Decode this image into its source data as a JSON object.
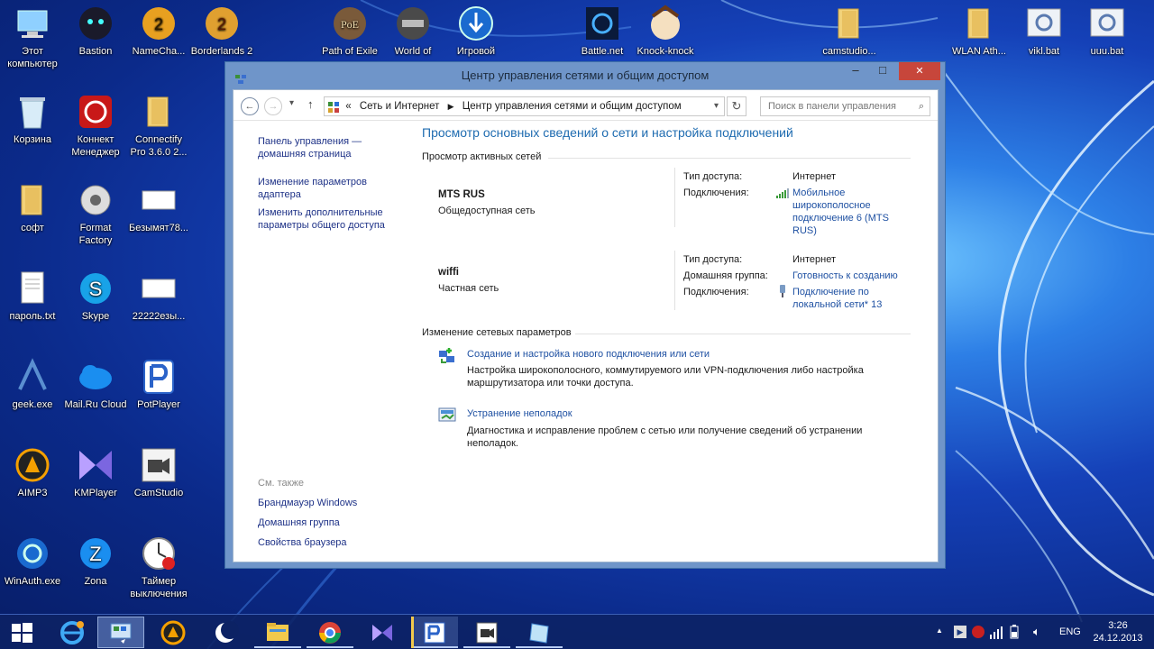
{
  "colors": {
    "accent": "#1e50a2",
    "title_blue": "#1e6bb0",
    "close_red": "#c7463b"
  },
  "desktop": {
    "icons": [
      {
        "label": "Этот компьютер",
        "icon": "computer-icon"
      },
      {
        "label": "Bastion",
        "icon": "bastion-icon"
      },
      {
        "label": "NameCha...",
        "icon": "namechanger-icon"
      },
      {
        "label": "Borderlands 2",
        "icon": "borderlands-icon"
      },
      {
        "label": "Path of Exile",
        "icon": "poe-icon"
      },
      {
        "label": "World of",
        "icon": "wot-icon"
      },
      {
        "label": "Игровой",
        "icon": "game-center-icon"
      },
      {
        "label": "Battle.net",
        "icon": "battlenet-icon"
      },
      {
        "label": "Knock-knock",
        "icon": "knock-icon"
      },
      {
        "label": "camstudio...",
        "icon": "folder-icon"
      },
      {
        "label": "WLAN Ath...",
        "icon": "folder-icon"
      },
      {
        "label": "vikl.bat",
        "icon": "bat-icon"
      },
      {
        "label": "uuu.bat",
        "icon": "bat-icon"
      },
      {
        "label": "Корзина",
        "icon": "recycle-bin-icon"
      },
      {
        "label": "Коннект Менеджер",
        "icon": "connect-manager-icon"
      },
      {
        "label": "Connectify Pro 3.6.0 2...",
        "icon": "folder-icon"
      },
      {
        "label": "софт",
        "icon": "folder-icon"
      },
      {
        "label": "Format Factory",
        "icon": "format-factory-icon"
      },
      {
        "label": "Безымят78...",
        "icon": "image-file-icon"
      },
      {
        "label": "пароль.txt",
        "icon": "text-file-icon"
      },
      {
        "label": "Skype",
        "icon": "skype-icon"
      },
      {
        "label": "22222езы...",
        "icon": "image-file-icon"
      },
      {
        "label": "geek.exe",
        "icon": "geek-icon"
      },
      {
        "label": "Mail.Ru Cloud",
        "icon": "mailru-cloud-icon"
      },
      {
        "label": "PotPlayer",
        "icon": "potplayer-icon"
      },
      {
        "label": "AIMP3",
        "icon": "aimp-icon"
      },
      {
        "label": "KMPlayer",
        "icon": "kmplayer-icon"
      },
      {
        "label": "CamStudio",
        "icon": "camstudio-icon"
      },
      {
        "label": "WinAuth.exe",
        "icon": "winauth-icon"
      },
      {
        "label": "Zona",
        "icon": "zona-icon"
      },
      {
        "label": "Таймер выключения",
        "icon": "timer-icon"
      }
    ]
  },
  "window": {
    "title": "Центр управления сетями и общим доступом",
    "minimize": "–",
    "maximize": "□",
    "close": "✕",
    "nav": {
      "back": "←",
      "forward": "→",
      "dropdown": "▾",
      "up": "↑",
      "breadcrumb_chevron": "«",
      "breadcrumb": [
        "Сеть и Интернет",
        "Центр управления сетями и общим доступом"
      ],
      "refresh": "↻",
      "search_placeholder": "Поиск в панели управления"
    },
    "left": {
      "links": [
        "Панель управления — домашняя страница",
        "Изменение параметров адаптера",
        "Изменить дополнительные параметры общего доступа"
      ],
      "see_also_title": "См. также",
      "see_also": [
        "Брандмауэр Windows",
        "Домашняя группа",
        "Свойства браузера"
      ]
    },
    "main": {
      "heading": "Просмотр основных сведений о сети и настройка подключений",
      "active_title": "Просмотр активных сетей",
      "networks": [
        {
          "name": "MTS RUS",
          "type": "Общедоступная сеть",
          "access_label": "Тип доступа:",
          "access": "Интернет",
          "conn_label": "Подключения:",
          "connection": "Мобильное широкополосное подключение 6 (MTS RUS)"
        },
        {
          "name": "wiffi",
          "type": "Частная сеть",
          "access_label": "Тип доступа:",
          "access": "Интернет",
          "home_label": "Домашняя группа:",
          "home": "Готовность к созданию",
          "conn_label": "Подключения:",
          "connection": "Подключение по локальной сети* 13"
        }
      ],
      "change_title": "Изменение сетевых параметров",
      "tasks": [
        {
          "link": "Создание и настройка нового подключения или сети",
          "desc": "Настройка широкополосного, коммутируемого или VPN-подключения либо настройка маршрутизатора или точки доступа."
        },
        {
          "link": "Устранение неполадок",
          "desc": "Диагностика и исправление проблем с сетью или получение сведений об устранении неполадок."
        }
      ]
    }
  },
  "taskbar": {
    "lang": "ENG",
    "time": "3:26",
    "date": "24.12.2013",
    "tray_up": "▲"
  }
}
